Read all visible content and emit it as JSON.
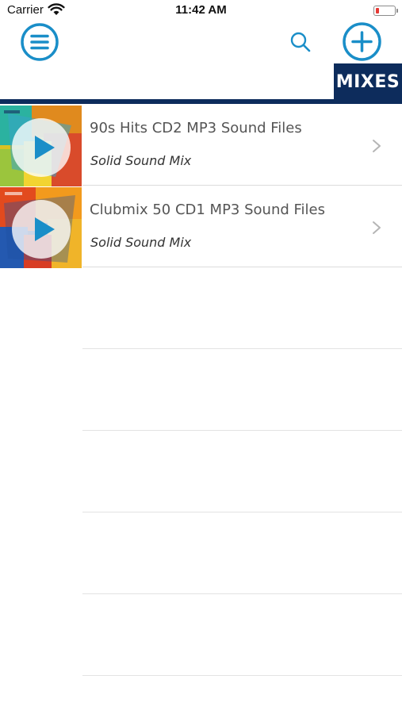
{
  "status_bar": {
    "carrier": "Carrier",
    "time": "11:42 AM",
    "battery_color": "#e53935"
  },
  "nav": {
    "menu_icon": "hamburger-circle-icon",
    "search_icon": "search-icon",
    "add_icon": "plus-circle-icon",
    "accent_color": "#1a8ec8"
  },
  "section": {
    "title": "MIXES",
    "color": "#0d2c5c"
  },
  "mixes": [
    {
      "title": "90s Hits CD2 MP3 Sound Files",
      "subtitle": "Solid Sound Mix"
    },
    {
      "title": "Clubmix 50 CD1 MP3 Sound Files",
      "subtitle": "Solid Sound Mix"
    }
  ]
}
